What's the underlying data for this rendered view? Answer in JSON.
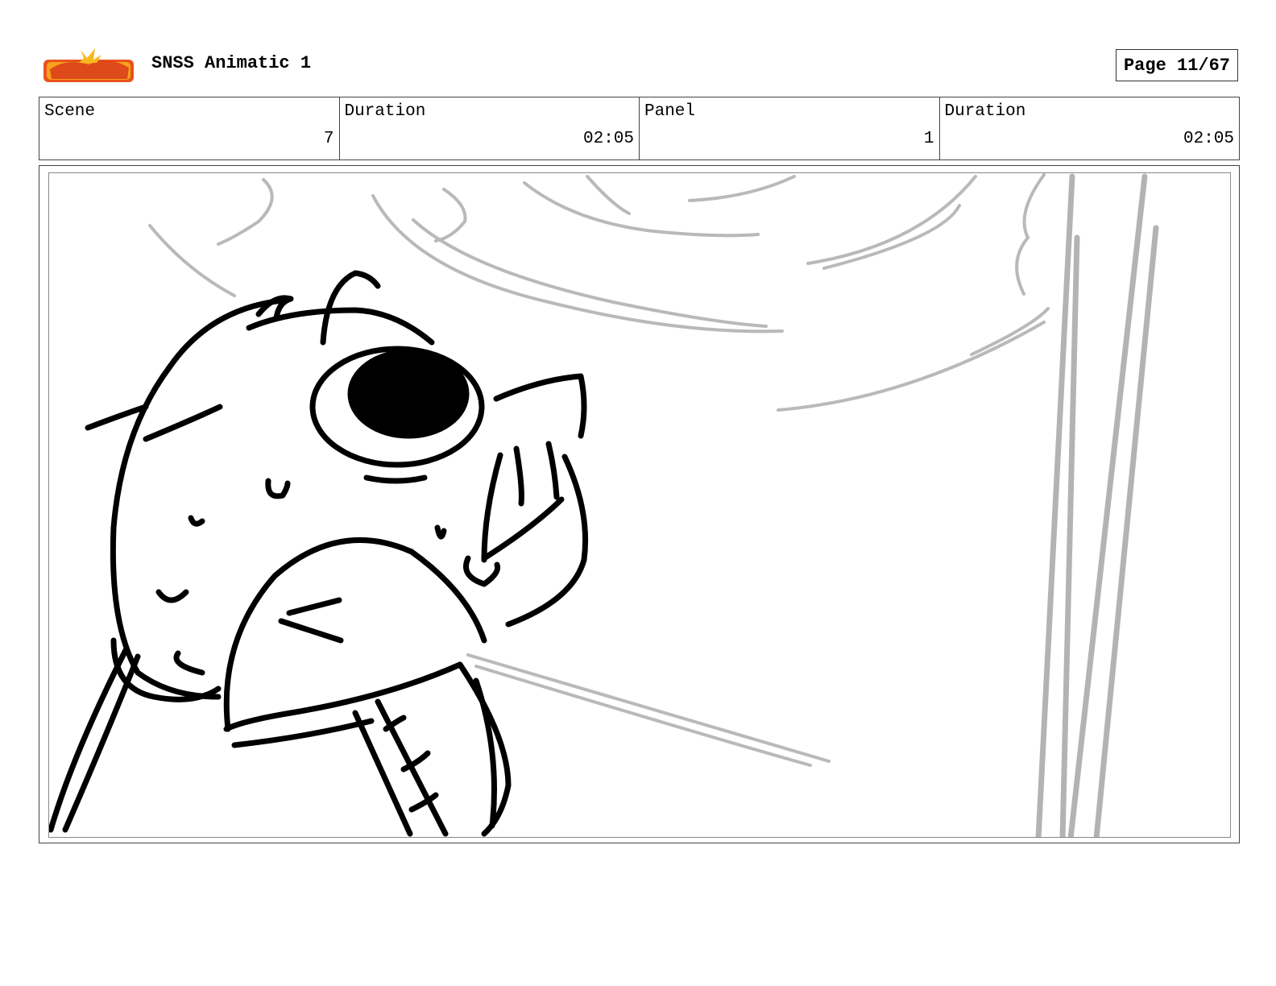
{
  "header": {
    "title": "SNSS Animatic 1",
    "page_label": "Page",
    "page_number": "11/67"
  },
  "info": {
    "scene_label": "Scene",
    "scene_value": "7",
    "scene_duration_label": "Duration",
    "scene_duration_value": "02:05",
    "panel_label": "Panel",
    "panel_value": "1",
    "panel_duration_label": "Duration",
    "panel_duration_value": "02:05"
  }
}
